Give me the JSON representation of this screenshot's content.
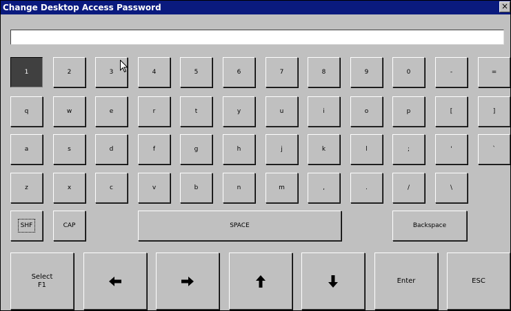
{
  "window": {
    "title": "Change Desktop Access Password",
    "close_label": "×"
  },
  "password_field": {
    "value": "",
    "placeholder": ""
  },
  "keyboard": {
    "row1": [
      "1",
      "2",
      "3",
      "4",
      "5",
      "6",
      "7",
      "8",
      "9",
      "0",
      "-",
      "="
    ],
    "row2": [
      "q",
      "w",
      "e",
      "r",
      "t",
      "y",
      "u",
      "i",
      "o",
      "p",
      "[",
      "]"
    ],
    "row3": [
      "a",
      "s",
      "d",
      "f",
      "g",
      "h",
      "j",
      "k",
      "l",
      ";",
      "'",
      "`"
    ],
    "row4": [
      "z",
      "x",
      "c",
      "v",
      "b",
      "n",
      "m",
      ",",
      ".",
      "/",
      "\\"
    ],
    "pressed_key": "1",
    "shift_label": "SHF",
    "caps_label": "CAP",
    "space_label": "SPACE",
    "backspace_label": "Backspace"
  },
  "nav": {
    "select_line1": "Select",
    "select_line2": "F1",
    "left_icon": "arrow-left-icon",
    "right_icon": "arrow-right-icon",
    "up_icon": "arrow-up-icon",
    "down_icon": "arrow-down-icon",
    "enter_label": "Enter",
    "esc_label": "ESC"
  },
  "colors": {
    "titlebar": "#0a1a7e",
    "surface": "#c0c0c0",
    "pressed_key": "#404040"
  }
}
